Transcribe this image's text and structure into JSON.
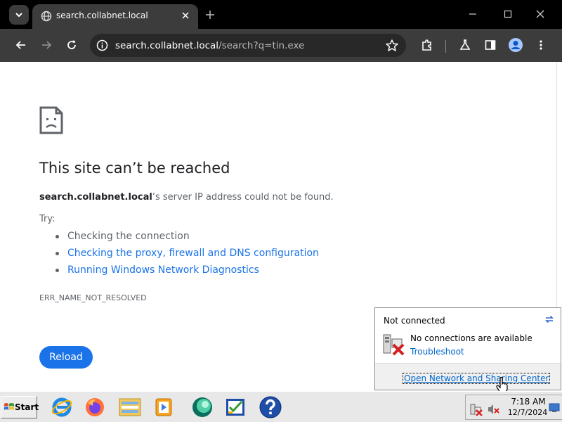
{
  "browser": {
    "tab": {
      "title": "search.collabnet.local"
    },
    "omnibox": {
      "host": "search.collabnet.local",
      "path": "/search?q=tin.exe"
    }
  },
  "page": {
    "heading": "This site can’t be reached",
    "host_bold": "search.collabnet.local",
    "description_rest": "’s server IP address could not be found.",
    "try_label": "Try:",
    "suggestions": [
      {
        "text": "Checking the connection"
      },
      {
        "text": "Checking the proxy, firewall and DNS configuration"
      },
      {
        "text": "Running Windows Network Diagnostics"
      }
    ],
    "error_code": "ERR_NAME_NOT_RESOLVED",
    "reload_label": "Reload"
  },
  "network_popup": {
    "title": "Not connected",
    "message": "No connections are available",
    "troubleshoot": "Troubleshoot",
    "open_center": "Open Network and Sharing Center"
  },
  "taskbar": {
    "start_label": "Start",
    "time": "7:18 AM",
    "date": "12/7/2024"
  },
  "colors": {
    "link_blue": "#1a73e8",
    "chrome_dark": "#3c3c3c",
    "error_red": "#d42020"
  }
}
